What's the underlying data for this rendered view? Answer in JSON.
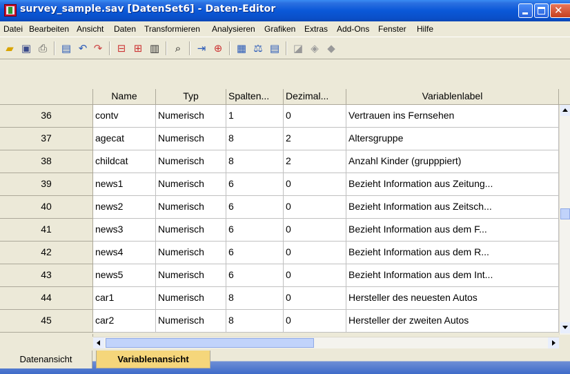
{
  "window": {
    "title": "survey_sample.sav [DatenSet6] - Daten-Editor"
  },
  "menu": [
    "Datei",
    "Bearbeiten",
    "Ansicht",
    "Daten",
    "Transformieren",
    "Analysieren",
    "Grafiken",
    "Extras",
    "Add-Ons",
    "Fenster",
    "Hilfe"
  ],
  "toolbar": {
    "icons": [
      "open-folder-icon",
      "save-icon",
      "print-icon",
      "dialog-recall-icon",
      "undo-icon",
      "redo-icon",
      "goto-case-icon",
      "goto-variable-icon",
      "variables-icon",
      "find-icon",
      "insert-cases-icon",
      "insert-variable-icon",
      "split-file-icon",
      "weight-cases-icon",
      "select-cases-icon",
      "value-labels-icon",
      "use-sets-icon",
      "show-all-variables-icon"
    ]
  },
  "grid": {
    "headers": [
      "Name",
      "Typ",
      "Spalten...",
      "Dezimal...",
      "Variablenlabel"
    ],
    "rows": [
      {
        "num": "36",
        "name": "contv",
        "typ": "Numerisch",
        "spalten": "1",
        "dezimal": "0",
        "label": "Vertrauen ins Fernsehen"
      },
      {
        "num": "37",
        "name": "agecat",
        "typ": "Numerisch",
        "spalten": "8",
        "dezimal": "2",
        "label": "Altersgruppe"
      },
      {
        "num": "38",
        "name": "childcat",
        "typ": "Numerisch",
        "spalten": "8",
        "dezimal": "2",
        "label": "Anzahl Kinder (grupppiert)"
      },
      {
        "num": "39",
        "name": "news1",
        "typ": "Numerisch",
        "spalten": "6",
        "dezimal": "0",
        "label": "Bezieht Information aus Zeitung..."
      },
      {
        "num": "40",
        "name": "news2",
        "typ": "Numerisch",
        "spalten": "6",
        "dezimal": "0",
        "label": "Bezieht Information aus Zeitsch..."
      },
      {
        "num": "41",
        "name": "news3",
        "typ": "Numerisch",
        "spalten": "6",
        "dezimal": "0",
        "label": "Bezieht Information aus dem F..."
      },
      {
        "num": "42",
        "name": "news4",
        "typ": "Numerisch",
        "spalten": "6",
        "dezimal": "0",
        "label": "Bezieht Information aus dem R..."
      },
      {
        "num": "43",
        "name": "news5",
        "typ": "Numerisch",
        "spalten": "6",
        "dezimal": "0",
        "label": "Bezieht Information aus dem Int..."
      },
      {
        "num": "44",
        "name": "car1",
        "typ": "Numerisch",
        "spalten": "8",
        "dezimal": "0",
        "label": "Hersteller des neuesten Autos"
      },
      {
        "num": "45",
        "name": "car2",
        "typ": "Numerisch",
        "spalten": "8",
        "dezimal": "0",
        "label": "Hersteller der zweiten Autos"
      }
    ]
  },
  "tabs": {
    "data_view": "Datenansicht",
    "variable_view": "Variablenansicht",
    "active": "variable_view"
  },
  "colors": {
    "titlebar": "#0a58d8",
    "active_tab": "#f5d67b",
    "chrome": "#ece9d8"
  }
}
